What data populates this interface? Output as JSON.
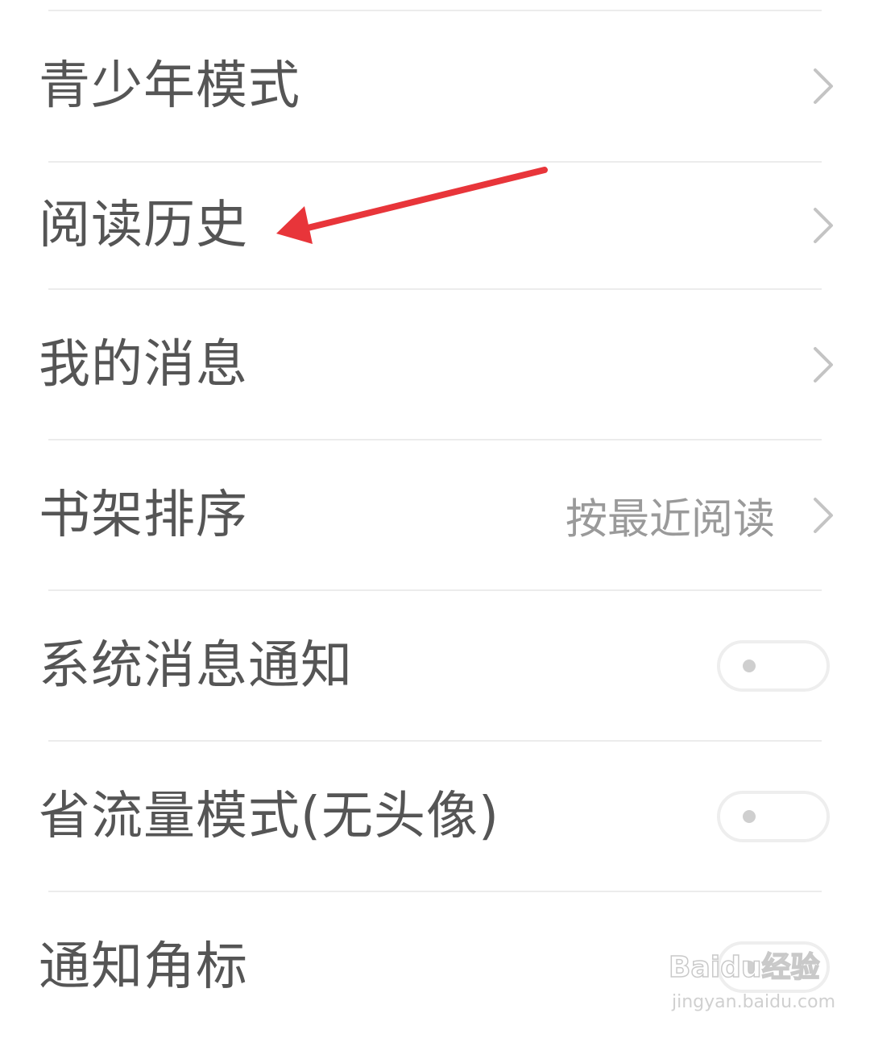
{
  "settings": {
    "items": [
      {
        "label": "青少年模式",
        "type": "link"
      },
      {
        "label": "阅读历史",
        "type": "link"
      },
      {
        "label": "我的消息",
        "type": "link"
      },
      {
        "label": "书架排序",
        "type": "link",
        "value": "按最近阅读"
      },
      {
        "label": "系统消息通知",
        "type": "toggle",
        "on": false
      },
      {
        "label": "省流量模式(无头像)",
        "type": "toggle",
        "on": false
      },
      {
        "label": "通知角标",
        "type": "toggle",
        "on": false
      }
    ]
  },
  "annotation": {
    "arrow_color": "#e8353a",
    "points_to": "阅读历史"
  },
  "watermark": {
    "logo": "Baidu经验",
    "url": "jingyan.baidu.com"
  },
  "colors": {
    "label": "#555555",
    "value": "#9a9a9a",
    "divider": "#ececec",
    "chevron": "#c4c4c4"
  }
}
